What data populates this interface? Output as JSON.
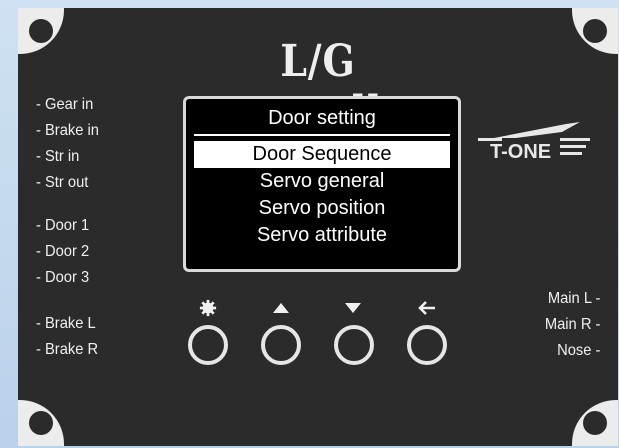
{
  "device": {
    "title": "L/G controller"
  },
  "left_labels": {
    "group1": [
      "- Gear in",
      "- Brake in",
      "- Str in",
      "- Str out"
    ],
    "group2": [
      "- Door 1",
      "- Door 2",
      "- Door 3"
    ],
    "group3": [
      "- Brake L",
      "- Brake R"
    ]
  },
  "right_labels": [
    "Main L -",
    "Main R -",
    "Nose   -"
  ],
  "screen": {
    "title": "Door setting",
    "menu": [
      "Door Sequence",
      "Servo general",
      "Servo position",
      "Servo attribute"
    ],
    "selected_index": 0
  },
  "brand": {
    "logo_text": "T-ONE"
  },
  "buttons": [
    {
      "icon": "gear-icon"
    },
    {
      "icon": "arrow-up-icon"
    },
    {
      "icon": "arrow-down-icon"
    },
    {
      "icon": "arrow-left-icon"
    }
  ],
  "colors": {
    "panel": "#2b2b2b",
    "text": "#f0f0f0",
    "accent_line": "#ffffff",
    "background": "#c5dbf0"
  }
}
